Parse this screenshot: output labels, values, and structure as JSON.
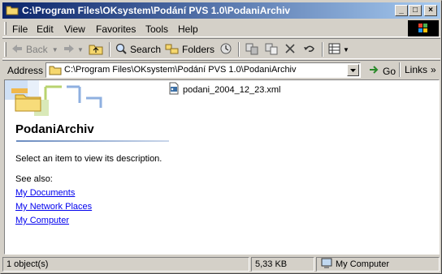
{
  "window": {
    "title": "C:\\Program Files\\OKsystem\\Podání PVS 1.0\\PodaniArchiv",
    "minimize": "_",
    "maximize": "□",
    "close": "×"
  },
  "menu": [
    {
      "label": "File"
    },
    {
      "label": "Edit"
    },
    {
      "label": "View"
    },
    {
      "label": "Favorites"
    },
    {
      "label": "Tools"
    },
    {
      "label": "Help"
    }
  ],
  "toolbar": {
    "back_label": "Back",
    "search_label": "Search",
    "folders_label": "Folders"
  },
  "address": {
    "label": "Address",
    "value": "C:\\Program Files\\OKsystem\\Podání PVS 1.0\\PodaniArchiv",
    "go_label": "Go",
    "links_label": "Links"
  },
  "webview": {
    "folder_name": "PodaniArchiv",
    "description": "Select an item to view its description.",
    "see_also": "See also:",
    "links": [
      "My Documents",
      "My Network Places",
      "My Computer"
    ]
  },
  "files": [
    {
      "name": "podani_2004_12_23.xml",
      "icon": "xml-file-icon"
    }
  ],
  "status": {
    "objects": "1 object(s)",
    "size": "5,33 KB",
    "location": "My Computer"
  },
  "colors": {
    "title_start": "#0a246a",
    "title_end": "#a6caf0",
    "chrome": "#d4d0c8",
    "link": "#0000ee"
  }
}
